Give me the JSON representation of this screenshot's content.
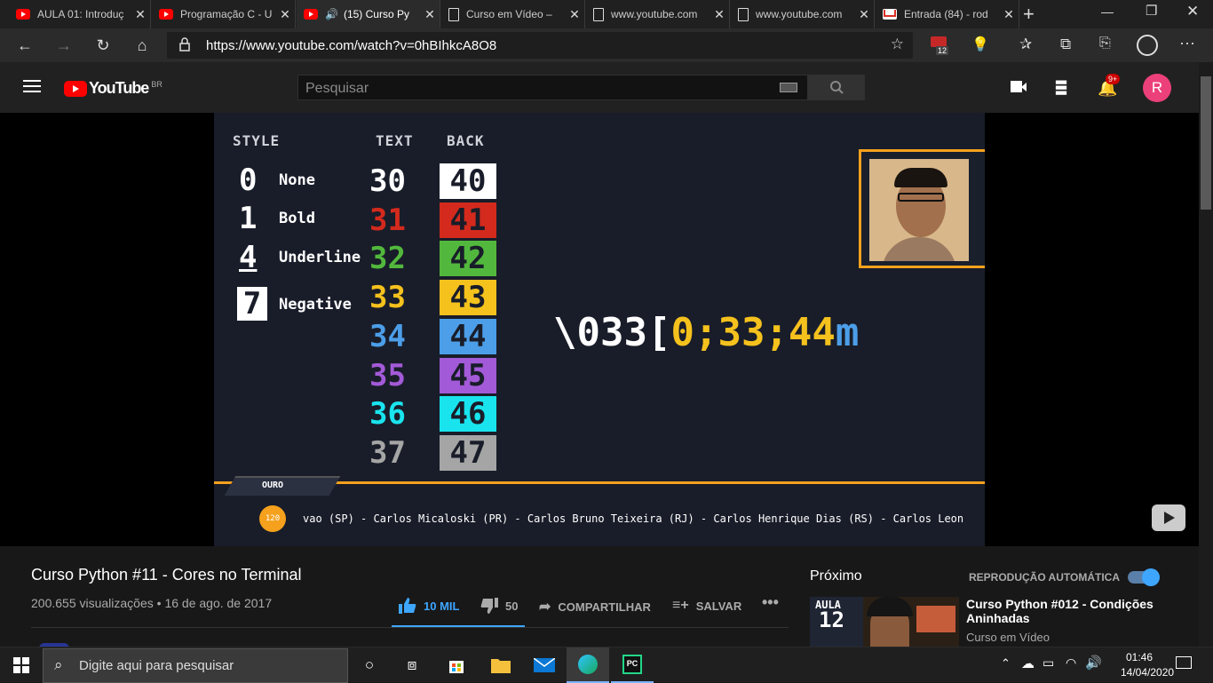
{
  "tabs": [
    {
      "label": "AULA 01: Introduç",
      "icon": "youtube-icon"
    },
    {
      "label": "Programação C - U",
      "icon": "youtube-icon"
    },
    {
      "label": "(15) Curso Py",
      "icon": "youtube-icon",
      "audio": "🔊"
    },
    {
      "label": "Curso em Vídeo –",
      "icon": "page-icon"
    },
    {
      "label": "www.youtube.com",
      "icon": "page-icon"
    },
    {
      "label": "www.youtube.com",
      "icon": "page-icon"
    },
    {
      "label": "Entrada (84) - rod",
      "icon": "gmail-icon"
    }
  ],
  "address": {
    "url": "https://www.youtube.com/watch?v=0hBIhkcA8O8",
    "ext_badge": "12"
  },
  "youtube": {
    "logo": "YouTube",
    "region": "BR",
    "search_placeholder": "Pesquisar",
    "notification_count": "9+",
    "avatar_letter": "R"
  },
  "video_frame": {
    "headers": {
      "style": "STYLE",
      "text": "TEXT",
      "back": "BACK"
    },
    "styles": [
      {
        "num": "0",
        "label": "None"
      },
      {
        "num": "1",
        "label": "Bold"
      },
      {
        "num": "4",
        "label": "Underline"
      },
      {
        "num": "7",
        "label": "Negative"
      }
    ],
    "text_codes": [
      "30",
      "31",
      "32",
      "33",
      "34",
      "35",
      "36",
      "37"
    ],
    "back_codes": [
      "40",
      "41",
      "42",
      "43",
      "44",
      "45",
      "46",
      "47"
    ],
    "colors": [
      "#ffffff",
      "#d42a1d",
      "#52b83d",
      "#f5c11d",
      "#4c9ee8",
      "#a35ad8",
      "#19e4ee",
      "#a5a5a5"
    ],
    "escape_seq": {
      "part1": "\\033",
      "part2": "[",
      "part3": "0;33;44",
      "part4": "m"
    },
    "badge": "OURO",
    "medal": "120",
    "ticker": "vao (SP) - Carlos Micaloski (PR) - Carlos Bruno Teixeira (RJ) - Carlos Henrique Dias (RS) - Carlos Leon"
  },
  "video": {
    "title": "Curso Python #11 - Cores no Terminal",
    "views": "200.655 visualizações",
    "date": "16 de ago. de 2017",
    "likes": "10 MIL",
    "dislikes": "50",
    "share": "COMPARTILHAR",
    "save": "SALVAR"
  },
  "upnext": {
    "heading": "Próximo",
    "autoplay": "REPRODUÇÃO AUTOMÁTICA",
    "thumb_label": "AULA",
    "thumb_num": "12",
    "title": "Curso Python #012 - Condições Aninhadas",
    "channel": "Curso em Vídeo"
  },
  "taskbar": {
    "search_placeholder": "Digite aqui para pesquisar",
    "time": "01:46",
    "date": "14/04/2020"
  }
}
